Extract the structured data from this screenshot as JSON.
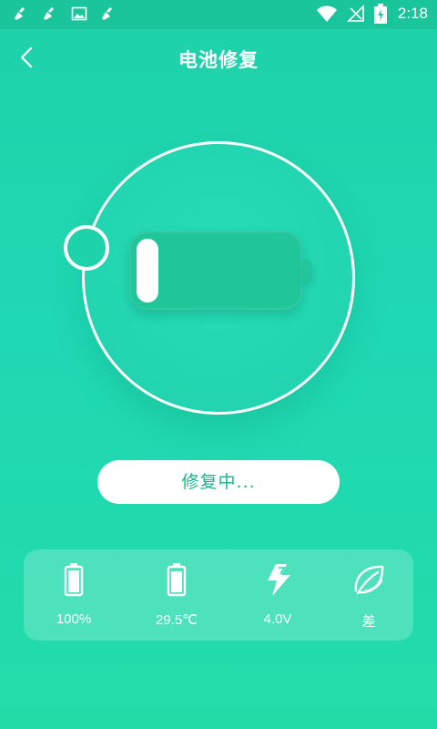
{
  "status_bar": {
    "time": "2:18",
    "icons": [
      "broom-icon",
      "broom-icon",
      "image-icon",
      "broom-icon",
      "wifi-icon",
      "no-signal-icon",
      "battery-charging-icon"
    ]
  },
  "header": {
    "title": "电池修复",
    "back_icon": "chevron-left-icon"
  },
  "repair": {
    "button_label": "修复中...",
    "progress": 0.1
  },
  "stats": [
    {
      "icon": "battery-icon",
      "label": "100%"
    },
    {
      "icon": "thermometer-battery-icon",
      "label": "29.5℃"
    },
    {
      "icon": "lightning-icon",
      "label": "4.0V"
    },
    {
      "icon": "leaf-icon",
      "label": "差"
    }
  ],
  "colors": {
    "background": "#1fd8b4",
    "status_bar": "#1ac59c",
    "battery": "#20c59a",
    "button_text": "#18b48d"
  }
}
